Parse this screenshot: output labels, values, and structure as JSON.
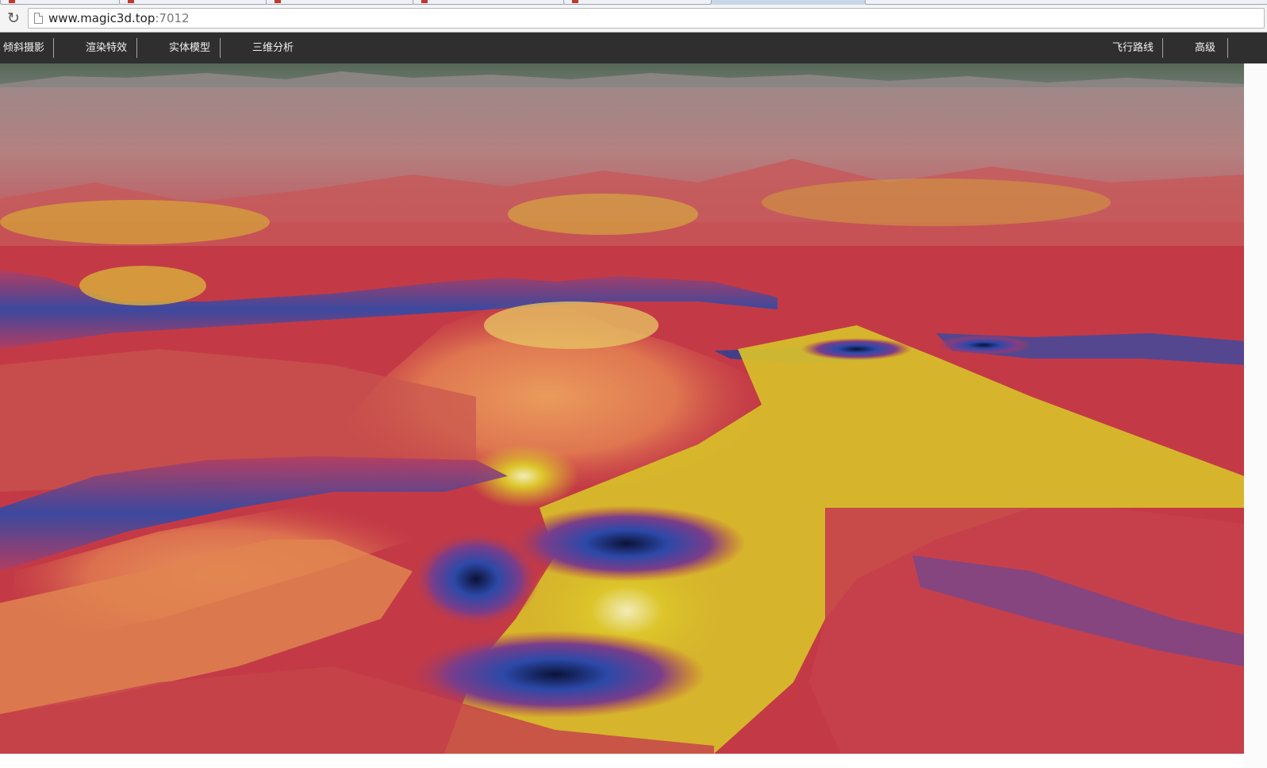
{
  "browser": {
    "url_host": "www.magic3d.top",
    "url_port": ":7012",
    "reload_icon": "reload-icon",
    "page_icon": "page-icon"
  },
  "nav": {
    "items_left": [
      "倾斜摄影",
      "渲染特效",
      "实体模型",
      "三维分析"
    ],
    "items_right": [
      "飞行路线",
      "高级"
    ]
  },
  "viewport": {
    "content": "3D terrain analysis heat map",
    "colors": {
      "sky": "#596a5a",
      "red": "#c33a46",
      "orange": "#e3834e",
      "yellow": "#d8c22a",
      "blue": "#2b4aa6",
      "dark": "#0f1a4a"
    }
  }
}
